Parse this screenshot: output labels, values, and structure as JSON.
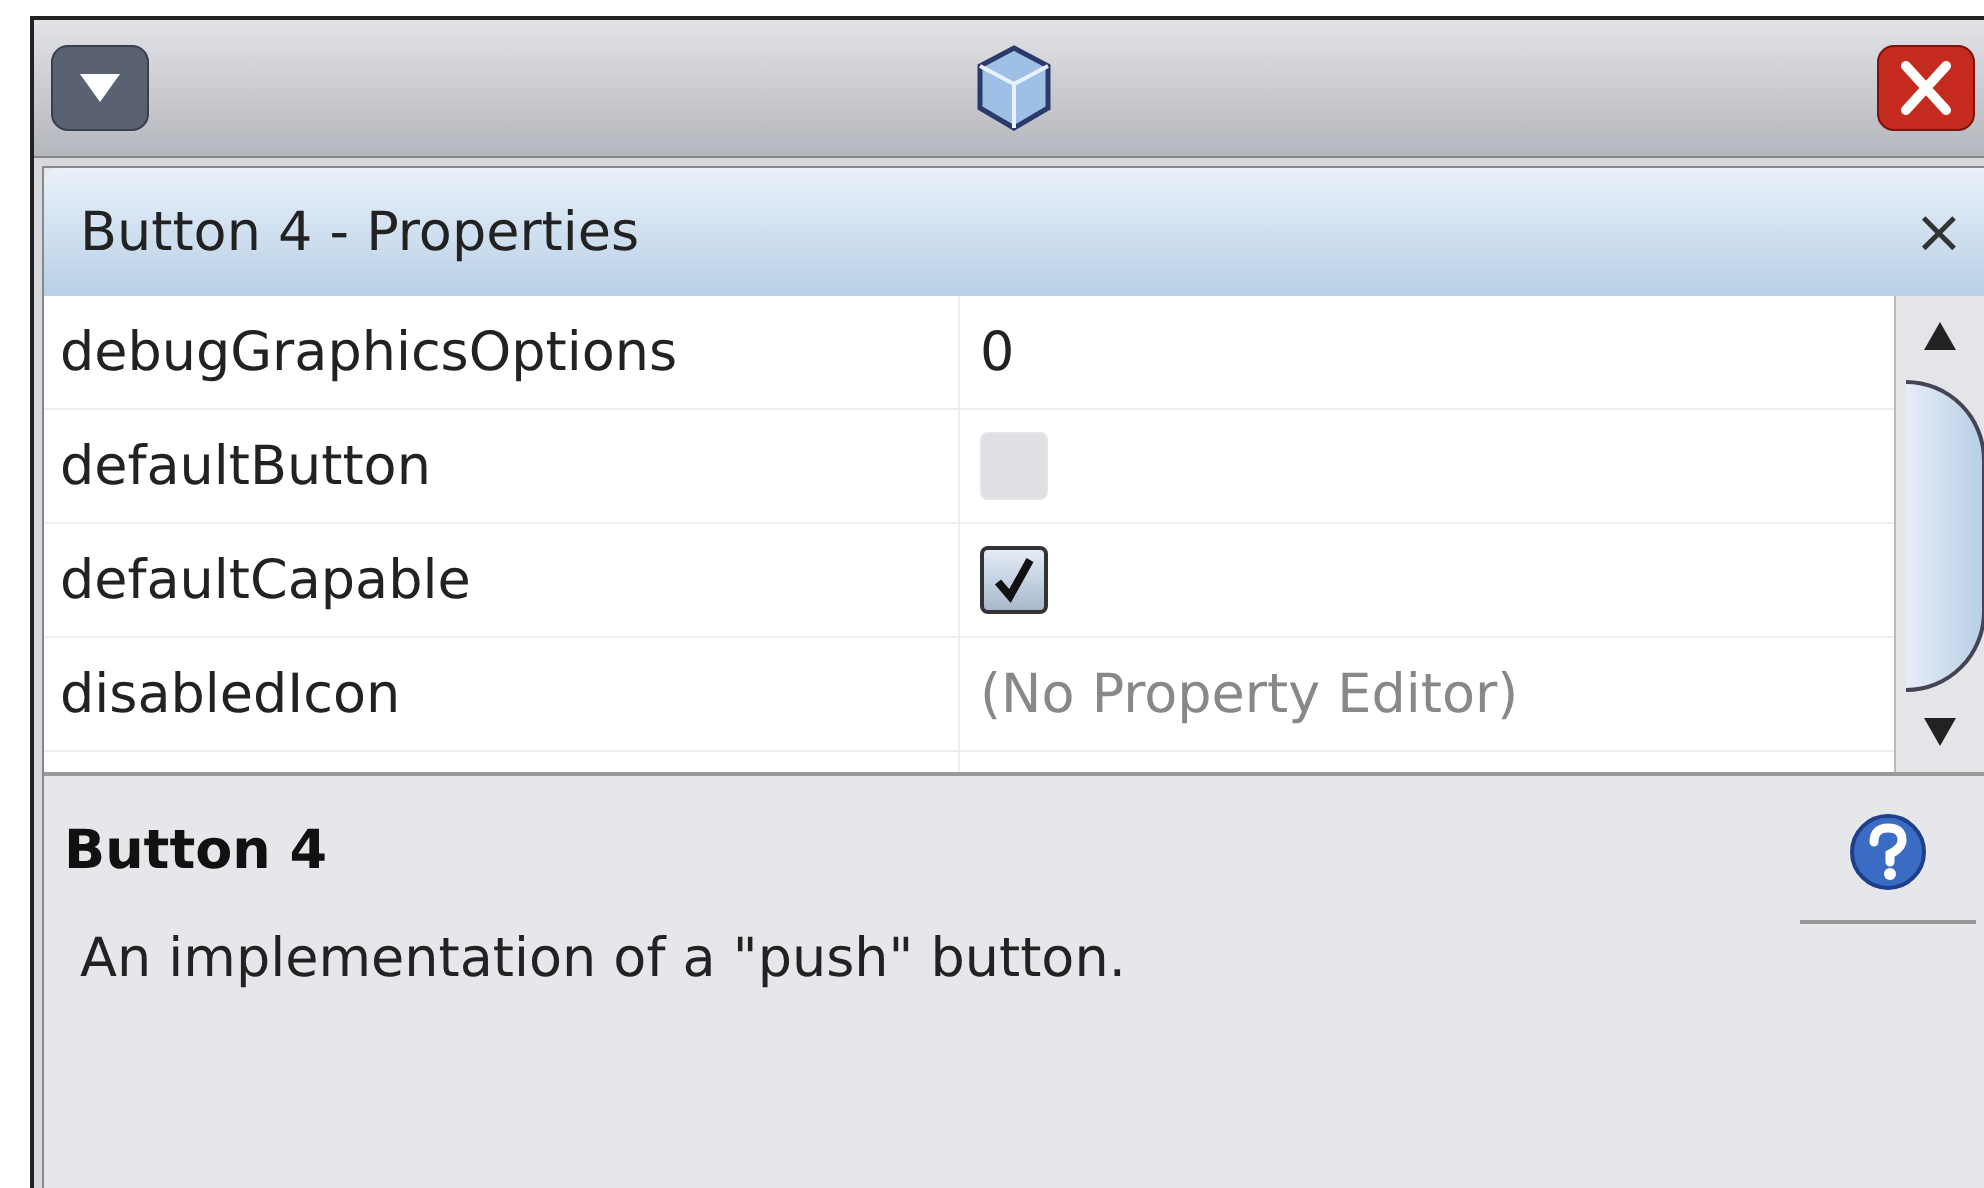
{
  "panel": {
    "title": "Button 4 - Properties",
    "close": "×"
  },
  "properties": [
    {
      "name": "debugGraphicsOptions",
      "kind": "text",
      "value": "0"
    },
    {
      "name": "defaultButton",
      "kind": "checkbox",
      "checked": false,
      "disabled": true
    },
    {
      "name": "defaultCapable",
      "kind": "checkbox",
      "checked": true,
      "disabled": false
    },
    {
      "name": "disabledIcon",
      "kind": "placeholder",
      "value": "(No Property Editor)"
    }
  ],
  "description": {
    "title": "Button 4",
    "text": "An implementation of a \"push\" button."
  }
}
